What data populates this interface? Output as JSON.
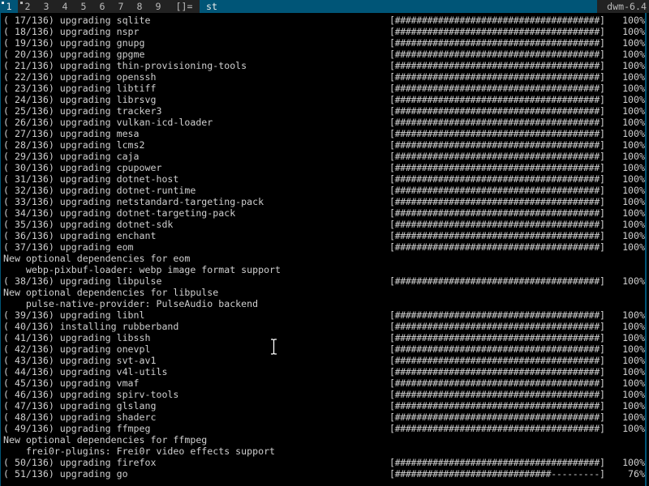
{
  "bar": {
    "tags": [
      {
        "label": "1",
        "selected": true,
        "occupied": true
      },
      {
        "label": "2",
        "selected": false,
        "occupied": true
      },
      {
        "label": "3",
        "selected": false,
        "occupied": false
      },
      {
        "label": "4",
        "selected": false,
        "occupied": false
      },
      {
        "label": "5",
        "selected": false,
        "occupied": false
      },
      {
        "label": "6",
        "selected": false,
        "occupied": false
      },
      {
        "label": "7",
        "selected": false,
        "occupied": false
      },
      {
        "label": "8",
        "selected": false,
        "occupied": false
      },
      {
        "label": "9",
        "selected": false,
        "occupied": false
      }
    ],
    "layout_symbol": "[]=",
    "window_title": "st",
    "status_text": "dwm-6.4"
  },
  "colors": {
    "bar_bg": "#222222",
    "bar_fg": "#bbbbbb",
    "selected_bg": "#005577",
    "selected_fg": "#eeeeee",
    "terminal_bg": "#000000",
    "terminal_fg": "#cfcfcf"
  },
  "terminal": {
    "lines": [
      {
        "text": "( 17/136) upgrading sqlite",
        "bar": "[######################################]",
        "pct": "100%"
      },
      {
        "text": "( 18/136) upgrading nspr",
        "bar": "[######################################]",
        "pct": "100%"
      },
      {
        "text": "( 19/136) upgrading gnupg",
        "bar": "[######################################]",
        "pct": "100%"
      },
      {
        "text": "( 20/136) upgrading gpgme",
        "bar": "[######################################]",
        "pct": "100%"
      },
      {
        "text": "( 21/136) upgrading thin-provisioning-tools",
        "bar": "[######################################]",
        "pct": "100%"
      },
      {
        "text": "( 22/136) upgrading openssh",
        "bar": "[######################################]",
        "pct": "100%"
      },
      {
        "text": "( 23/136) upgrading libtiff",
        "bar": "[######################################]",
        "pct": "100%"
      },
      {
        "text": "( 24/136) upgrading librsvg",
        "bar": "[######################################]",
        "pct": "100%"
      },
      {
        "text": "( 25/136) upgrading tracker3",
        "bar": "[######################################]",
        "pct": "100%"
      },
      {
        "text": "( 26/136) upgrading vulkan-icd-loader",
        "bar": "[######################################]",
        "pct": "100%"
      },
      {
        "text": "( 27/136) upgrading mesa",
        "bar": "[######################################]",
        "pct": "100%"
      },
      {
        "text": "( 28/136) upgrading lcms2",
        "bar": "[######################################]",
        "pct": "100%"
      },
      {
        "text": "( 29/136) upgrading caja",
        "bar": "[######################################]",
        "pct": "100%"
      },
      {
        "text": "( 30/136) upgrading cpupower",
        "bar": "[######################################]",
        "pct": "100%"
      },
      {
        "text": "( 31/136) upgrading dotnet-host",
        "bar": "[######################################]",
        "pct": "100%"
      },
      {
        "text": "( 32/136) upgrading dotnet-runtime",
        "bar": "[######################################]",
        "pct": "100%"
      },
      {
        "text": "( 33/136) upgrading netstandard-targeting-pack",
        "bar": "[######################################]",
        "pct": "100%"
      },
      {
        "text": "( 34/136) upgrading dotnet-targeting-pack",
        "bar": "[######################################]",
        "pct": "100%"
      },
      {
        "text": "( 35/136) upgrading dotnet-sdk",
        "bar": "[######################################]",
        "pct": "100%"
      },
      {
        "text": "( 36/136) upgrading enchant",
        "bar": "[######################################]",
        "pct": "100%"
      },
      {
        "text": "( 37/136) upgrading eom",
        "bar": "[######################################]",
        "pct": "100%"
      },
      {
        "text": "New optional dependencies for eom",
        "bar": "",
        "pct": ""
      },
      {
        "text": "    webp-pixbuf-loader: webp image format support",
        "bar": "",
        "pct": ""
      },
      {
        "text": "( 38/136) upgrading libpulse",
        "bar": "[######################################]",
        "pct": "100%"
      },
      {
        "text": "New optional dependencies for libpulse",
        "bar": "",
        "pct": ""
      },
      {
        "text": "    pulse-native-provider: PulseAudio backend",
        "bar": "",
        "pct": ""
      },
      {
        "text": "( 39/136) upgrading libnl",
        "bar": "[######################################]",
        "pct": "100%"
      },
      {
        "text": "( 40/136) installing rubberband",
        "bar": "[######################################]",
        "pct": "100%"
      },
      {
        "text": "( 41/136) upgrading libssh",
        "bar": "[######################################]",
        "pct": "100%"
      },
      {
        "text": "( 42/136) upgrading onevpl",
        "bar": "[######################################]",
        "pct": "100%"
      },
      {
        "text": "( 43/136) upgrading svt-av1",
        "bar": "[######################################]",
        "pct": "100%"
      },
      {
        "text": "( 44/136) upgrading v4l-utils",
        "bar": "[######################################]",
        "pct": "100%"
      },
      {
        "text": "( 45/136) upgrading vmaf",
        "bar": "[######################################]",
        "pct": "100%"
      },
      {
        "text": "( 46/136) upgrading spirv-tools",
        "bar": "[######################################]",
        "pct": "100%"
      },
      {
        "text": "( 47/136) upgrading glslang",
        "bar": "[######################################]",
        "pct": "100%"
      },
      {
        "text": "( 48/136) upgrading shaderc",
        "bar": "[######################################]",
        "pct": "100%"
      },
      {
        "text": "( 49/136) upgrading ffmpeg",
        "bar": "[######################################]",
        "pct": "100%"
      },
      {
        "text": "New optional dependencies for ffmpeg",
        "bar": "",
        "pct": ""
      },
      {
        "text": "    frei0r-plugins: Frei0r video effects support",
        "bar": "",
        "pct": ""
      },
      {
        "text": "( 50/136) upgrading firefox",
        "bar": "[######################################]",
        "pct": "100%"
      },
      {
        "text": "( 51/136) upgrading go",
        "bar": "[#############################---------]",
        "pct": "76%"
      }
    ]
  },
  "cursor": {
    "icon": "ibeam-cursor-icon"
  }
}
